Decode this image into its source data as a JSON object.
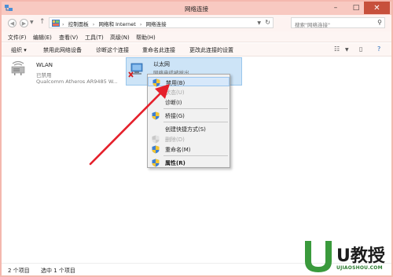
{
  "window": {
    "title": "网络连接",
    "controls": {
      "minimize": "–",
      "maximize": "□",
      "close": "✕"
    }
  },
  "address_bar": {
    "crumbs": [
      "控制面板",
      "网络和 Internet",
      "网络连接"
    ],
    "separator": "›",
    "search_placeholder": "搜索\"网络连接\""
  },
  "menu": [
    "文件(F)",
    "编辑(E)",
    "查看(V)",
    "工具(T)",
    "高级(N)",
    "帮助(H)"
  ],
  "toolbar": {
    "organize": "组织 ▾",
    "commands": [
      "禁用此网络设备",
      "诊断这个连接",
      "重命名此连接",
      "更改此连接的设置"
    ]
  },
  "adapters": [
    {
      "name": "WLAN",
      "status": "已禁用",
      "device": "Qualcomm Atheros AR9485 W..."
    },
    {
      "name": "以太网",
      "status": "网络电缆被拔出"
    }
  ],
  "context_menu": [
    {
      "label": "禁用(B)",
      "disabled": false,
      "bold": false,
      "shield": true
    },
    {
      "label": "状态(U)",
      "disabled": true,
      "bold": false,
      "shield": false
    },
    {
      "label": "诊断(I)",
      "disabled": false,
      "bold": false,
      "shield": false
    },
    {
      "label": "桥接(G)",
      "disabled": false,
      "bold": false,
      "shield": true
    },
    {
      "label": "创建快捷方式(S)",
      "disabled": false,
      "bold": false,
      "shield": false
    },
    {
      "label": "删除(D)",
      "disabled": true,
      "bold": false,
      "shield": true
    },
    {
      "label": "重命名(M)",
      "disabled": false,
      "bold": false,
      "shield": true
    },
    {
      "label": "属性(R)",
      "disabled": false,
      "bold": true,
      "shield": true
    }
  ],
  "status_bar": {
    "count": "2 个项目",
    "selected": "选中 1 个项目"
  },
  "watermark": {
    "big": "U教授",
    "small": "UJIAOSHOU.COM"
  },
  "colors": {
    "title_bar": "#f8c9c1",
    "close_button": "#c7503c",
    "selection": "#cde4f7",
    "arrow": "#e5202b"
  }
}
